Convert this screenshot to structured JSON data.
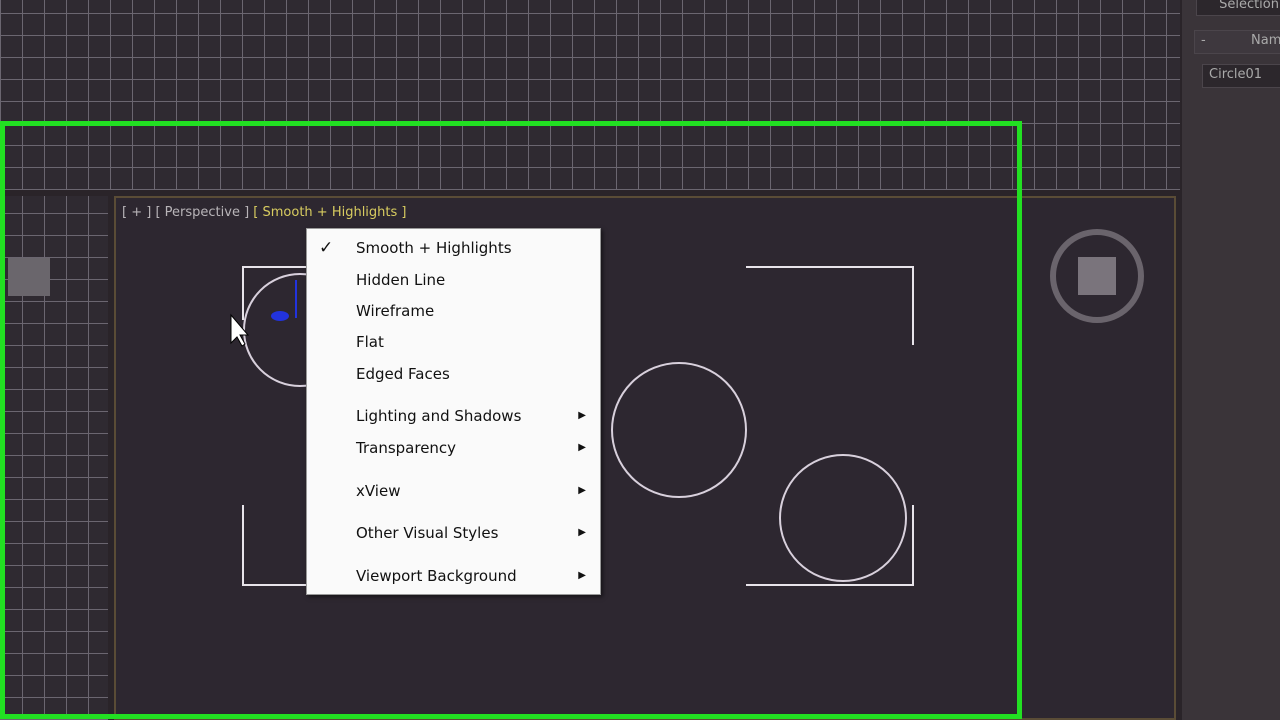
{
  "viewport": {
    "label_plus": "[ + ]",
    "label_view": "[ Perspective ]",
    "label_style": "[ Smooth + Highlights ]"
  },
  "right_panel": {
    "section": "Selection",
    "name_header": "Name",
    "object_name": "Circle01",
    "collapse": "-"
  },
  "menu": {
    "items": [
      {
        "label": "Smooth + Highlights",
        "checked": true,
        "submenu": false
      },
      {
        "label": "Hidden Line",
        "checked": false,
        "submenu": false
      },
      {
        "label": "Wireframe",
        "checked": false,
        "submenu": false
      },
      {
        "label": "Flat",
        "checked": false,
        "submenu": false
      },
      {
        "label": "Edged Faces",
        "checked": false,
        "submenu": false
      },
      {
        "label": "Lighting and Shadows",
        "checked": false,
        "submenu": true
      },
      {
        "label": "Transparency",
        "checked": false,
        "submenu": true
      },
      {
        "label": "xView",
        "checked": false,
        "submenu": true
      },
      {
        "label": "Other Visual Styles",
        "checked": false,
        "submenu": true
      },
      {
        "label": "Viewport Background",
        "checked": false,
        "submenu": true
      }
    ],
    "check_glyph": "✓",
    "arrow_glyph": "▶"
  },
  "colors": {
    "highlight": "#22e022",
    "label_yellow": "#d8cc60"
  }
}
